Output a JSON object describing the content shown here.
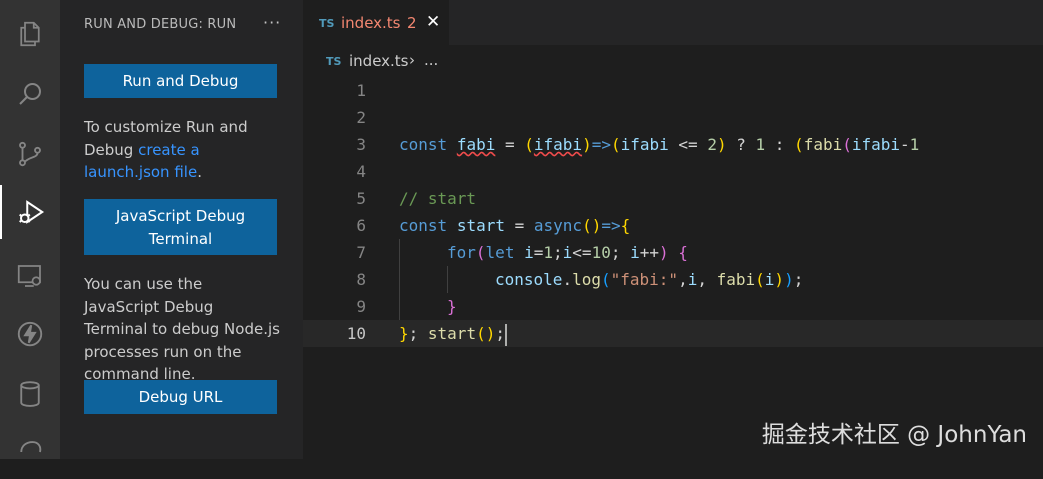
{
  "sidebar": {
    "title": "RUN AND DEBUG: RUN",
    "more": "···",
    "run_debug_label": "Run and Debug",
    "customize_text": "To customize Run and Debug ",
    "customize_link": "create a launch.json file",
    "customize_end": ".",
    "js_terminal_label": "JavaScript Debug Terminal",
    "terminal_desc": "You can use the JavaScript Debug Terminal to debug Node.js processes run on the command line.",
    "debug_url_label": "Debug URL"
  },
  "tab": {
    "badge": "TS",
    "name": "index.ts",
    "problems": "2",
    "close": "✕"
  },
  "breadcrumb": {
    "badge": "TS",
    "file": "index.ts",
    "separator": "›",
    "more": "..."
  },
  "editor": {
    "line_numbers": [
      "1",
      "2",
      "3",
      "4",
      "5",
      "6",
      "7",
      "8",
      "9",
      "10"
    ],
    "active_line": 10,
    "line3": "const fabi = (ifabi)=>(ifabi <= 2) ? 1 : (fabi(ifabi-1",
    "line5": "// start",
    "line6": "const start = async()=>{",
    "line7": "for(let i=1;i<=10; i++) {",
    "line8": "console.log(\"fabi:\",i, fabi(i));",
    "line9": "}",
    "line10": "}; start();"
  },
  "watermark": "掘金技术社区 @ JohnYan",
  "colors": {
    "accent": "#0e639c",
    "link": "#3794ff",
    "error": "#f48771"
  },
  "icons": [
    "files-icon",
    "search-icon",
    "source-control-icon",
    "run-debug-icon",
    "remote-explorer-icon",
    "lightning-icon",
    "database-icon",
    "elephant-icon"
  ]
}
